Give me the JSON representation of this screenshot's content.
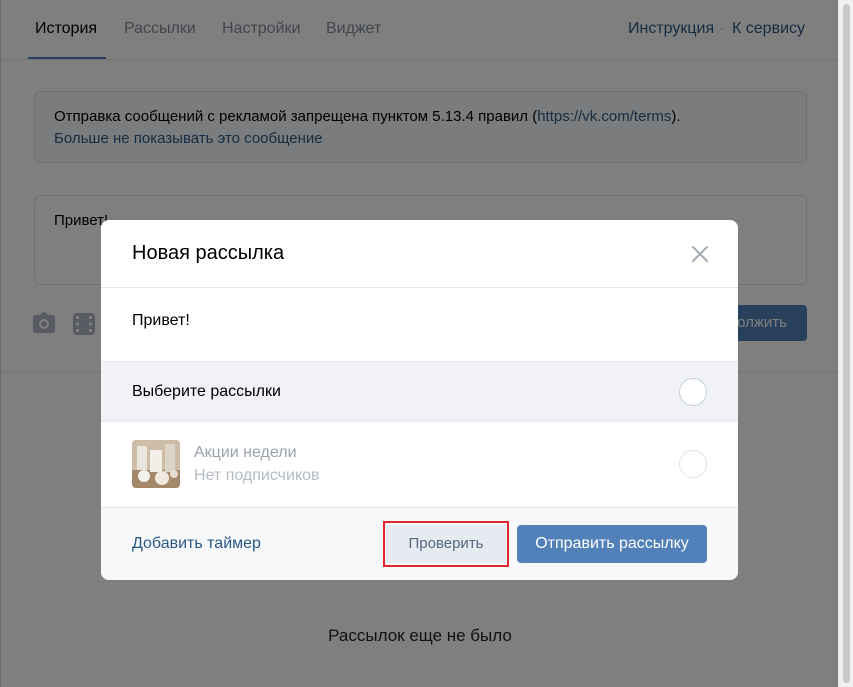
{
  "nav": {
    "tabs": [
      {
        "label": "История",
        "active": true
      },
      {
        "label": "Рассылки",
        "active": false
      },
      {
        "label": "Настройки",
        "active": false
      },
      {
        "label": "Виджет",
        "active": false
      }
    ],
    "instruction_label": "Инструкция",
    "separator": "·",
    "service_label": "К сервису"
  },
  "notice": {
    "text": "Отправка сообщений с рекламой запрещена пунктом 5.13.4 правил (",
    "link_text": "https://vk.com/terms",
    "text_end": ").",
    "dismiss_label": "Больше не показывать это сообщение"
  },
  "compose": {
    "text": "Привет!",
    "continue_label": "олжить"
  },
  "empty_state": "Рассылок еще не было",
  "modal": {
    "title": "Новая рассылка",
    "message": "Привет!",
    "select_label": "Выберите рассылки",
    "lists": [
      {
        "title": "Акции недели",
        "subtitle": "Нет подписчиков"
      }
    ],
    "timer_label": "Добавить таймер",
    "check_label": "Проверить",
    "send_label": "Отправить рассылку"
  },
  "colors": {
    "accent": "#5181b8",
    "link": "#2a5885",
    "highlight": "#e0252b"
  }
}
